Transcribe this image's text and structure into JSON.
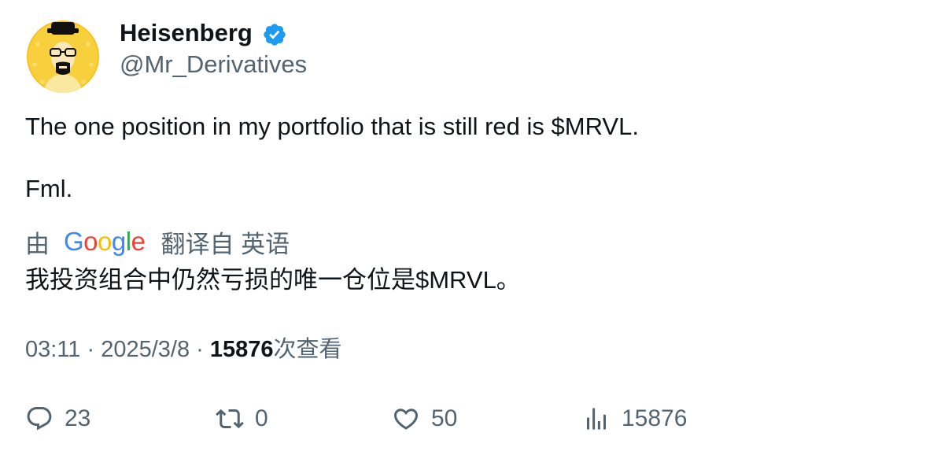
{
  "author": {
    "display_name": "Heisenberg",
    "handle": "@Mr_Derivatives",
    "verified": true,
    "verified_color": "#1d9bf0",
    "avatar_icon": "heisenberg-avatar-icon"
  },
  "tweet": {
    "line1": "The one position in my portfolio that is still red is $MRVL.",
    "line2": "Fml."
  },
  "translation": {
    "by_label": "由",
    "provider": "Google",
    "translated_from": "翻译自 英语",
    "translated_text": "我投资组合中仍然亏损的唯一仓位是$MRVL。"
  },
  "meta": {
    "time": "03:11",
    "separator": "·",
    "date": "2025/3/8",
    "views_count": "15876",
    "views_label": "次查看"
  },
  "actions": {
    "replies": "23",
    "retweets": "0",
    "likes": "50",
    "views": "15876"
  },
  "colors": {
    "text_primary": "#0f1419",
    "text_secondary": "#536471",
    "avatar_bg": "#f7c325"
  }
}
